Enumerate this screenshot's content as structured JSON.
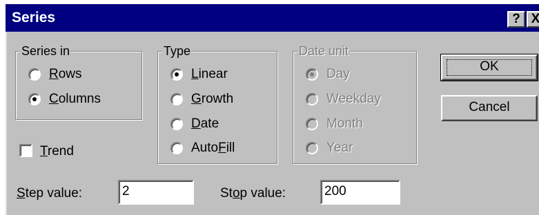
{
  "window": {
    "title": "Series",
    "help_button": "?",
    "close_button": "X"
  },
  "series_in": {
    "legend": "Series in",
    "options": [
      {
        "label": "Rows",
        "accel": "R",
        "rest": "ows",
        "selected": false
      },
      {
        "label": "Columns",
        "accel": "C",
        "rest": "olumns",
        "selected": true
      }
    ]
  },
  "type": {
    "legend": "Type",
    "options": [
      {
        "label": "Linear",
        "accel": "L",
        "pre": "",
        "rest": "inear",
        "selected": true
      },
      {
        "label": "Growth",
        "accel": "G",
        "pre": "",
        "rest": "rowth",
        "selected": false
      },
      {
        "label": "Date",
        "accel": "D",
        "pre": "",
        "rest": "ate",
        "selected": false
      },
      {
        "label": "AutoFill",
        "accel": "F",
        "pre": "Auto",
        "rest": "ill",
        "selected": false
      }
    ]
  },
  "date_unit": {
    "legend": "Date unit",
    "enabled": false,
    "options": [
      {
        "label": "Day",
        "selected": true
      },
      {
        "label": "Weekday",
        "selected": false
      },
      {
        "label": "Month",
        "selected": false
      },
      {
        "label": "Year",
        "selected": false
      }
    ]
  },
  "trend": {
    "accel": "T",
    "rest": "rend",
    "checked": false
  },
  "step": {
    "accel": "S",
    "rest": "tep value:",
    "value": "2"
  },
  "stop": {
    "pre": "St",
    "accel": "o",
    "rest": "p value:",
    "value": "200"
  },
  "buttons": {
    "ok": "OK",
    "cancel": "Cancel"
  }
}
